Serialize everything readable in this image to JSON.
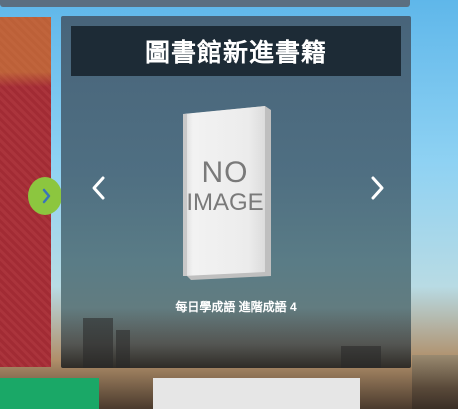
{
  "widget": {
    "title": "圖書館新進書籍",
    "book": {
      "cover_text": [
        "NO",
        "IMAGE"
      ],
      "title": "每日學成語 進階成語 4"
    },
    "prev_icon": "chevron-left-icon",
    "next_icon": "chevron-right-icon"
  },
  "colors": {
    "title_bg": "#1d2b36",
    "left_panel": "#a82d36",
    "green_dot": "#8cc63f",
    "bottom_green": "#1aa867",
    "bottom_gray": "#e6e6e6"
  }
}
